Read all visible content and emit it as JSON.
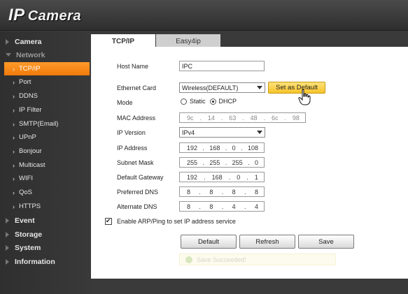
{
  "app": {
    "logo_ip": "IP",
    "logo_rest": "Camera"
  },
  "sidebar": {
    "items": [
      {
        "label": "Camera",
        "level": "top",
        "state": "collapsed"
      },
      {
        "label": "Network",
        "level": "top",
        "state": "open"
      },
      {
        "label": "TCP/IP",
        "level": "sub",
        "active": true
      },
      {
        "label": "Port",
        "level": "sub"
      },
      {
        "label": "DDNS",
        "level": "sub"
      },
      {
        "label": "IP Filter",
        "level": "sub"
      },
      {
        "label": "SMTP(Email)",
        "level": "sub"
      },
      {
        "label": "UPnP",
        "level": "sub"
      },
      {
        "label": "Bonjour",
        "level": "sub"
      },
      {
        "label": "Multicast",
        "level": "sub"
      },
      {
        "label": "WIFI",
        "level": "sub"
      },
      {
        "label": "QoS",
        "level": "sub"
      },
      {
        "label": "HTTPS",
        "level": "sub"
      },
      {
        "label": "Event",
        "level": "top",
        "state": "collapsed"
      },
      {
        "label": "Storage",
        "level": "top",
        "state": "collapsed"
      },
      {
        "label": "System",
        "level": "top",
        "state": "collapsed"
      },
      {
        "label": "Information",
        "level": "top",
        "state": "collapsed"
      }
    ]
  },
  "tabs": [
    {
      "label": "TCP/IP",
      "active": true
    },
    {
      "label": "Easy4ip",
      "active": false
    }
  ],
  "form": {
    "host_name": {
      "label": "Host Name",
      "value": "IPC"
    },
    "ethernet_card": {
      "label": "Ethernet Card",
      "value": "Wireless(DEFAULT)",
      "button": "Set as Default"
    },
    "mode": {
      "label": "Mode",
      "options": [
        "Static",
        "DHCP"
      ],
      "selected": "DHCP"
    },
    "mac_address": {
      "label": "MAC Address",
      "octets": [
        "9c",
        "14",
        "63",
        "48",
        "6c",
        "98"
      ]
    },
    "ip_version": {
      "label": "IP Version",
      "value": "IPv4"
    },
    "ip_address": {
      "label": "IP Address",
      "octets": [
        "192",
        "168",
        "0",
        "108"
      ]
    },
    "subnet_mask": {
      "label": "Subnet Mask",
      "octets": [
        "255",
        "255",
        "255",
        "0"
      ]
    },
    "default_gateway": {
      "label": "Default Gateway",
      "octets": [
        "192",
        "168",
        "0",
        "1"
      ]
    },
    "preferred_dns": {
      "label": "Preferred DNS",
      "octets": [
        "8",
        "8",
        "8",
        "8"
      ]
    },
    "alternate_dns": {
      "label": "Alternate DNS",
      "octets": [
        "8",
        "8",
        "4",
        "4"
      ]
    },
    "arp_ping": {
      "label": "Enable ARP/Ping to set IP address service",
      "checked": true
    }
  },
  "buttons": {
    "default": "Default",
    "refresh": "Refresh",
    "save": "Save"
  },
  "toast": {
    "text": "Save Succeeded!"
  },
  "colors": {
    "accent": "#f5861a",
    "button_highlight": "#f6c32a"
  }
}
